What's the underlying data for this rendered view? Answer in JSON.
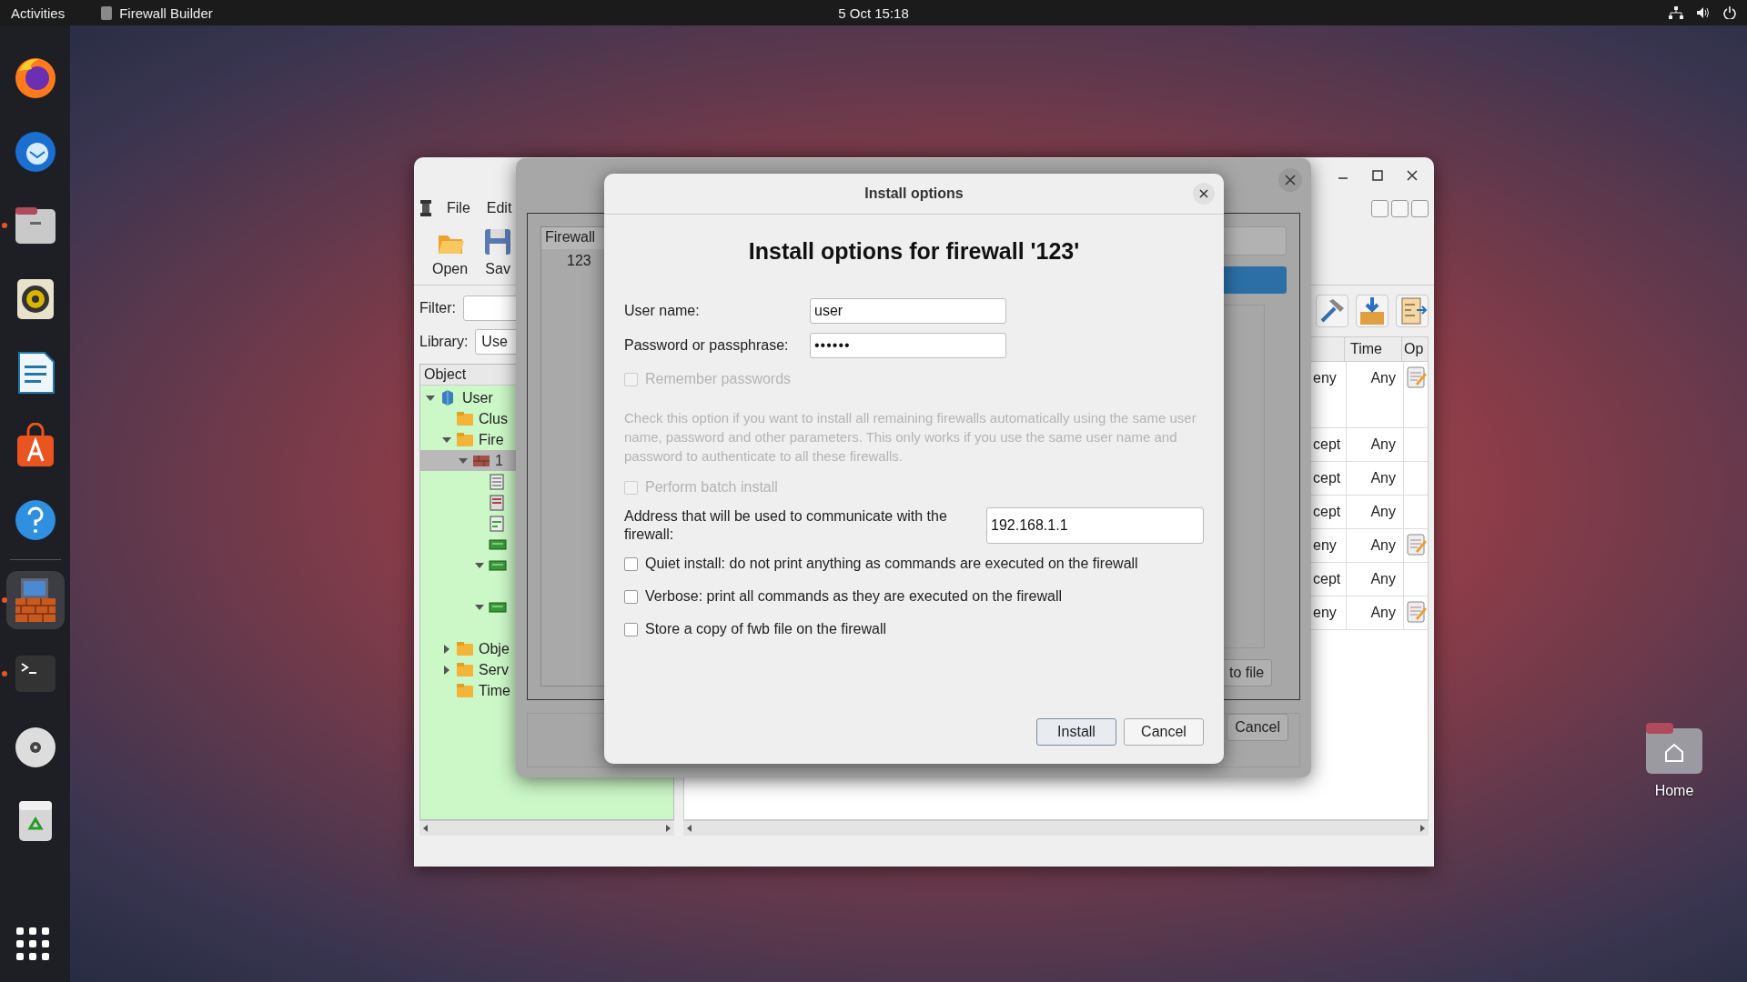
{
  "top_bar": {
    "activities": "Activities",
    "app_name": "Firewall Builder",
    "clock": "5 Oct  15:18"
  },
  "dock": [
    {
      "kind": "firefox",
      "running": false,
      "selected": false
    },
    {
      "kind": "mail",
      "running": false,
      "selected": false
    },
    {
      "kind": "files",
      "running": true,
      "selected": false
    },
    {
      "kind": "speaker",
      "running": false,
      "selected": false
    },
    {
      "kind": "writer",
      "running": false,
      "selected": false
    },
    {
      "kind": "store",
      "running": false,
      "selected": false
    },
    {
      "kind": "help",
      "running": false,
      "selected": false
    },
    {
      "kind": "firewall",
      "running": true,
      "selected": true
    },
    {
      "kind": "terminal",
      "running": true,
      "selected": false
    },
    {
      "kind": "disc",
      "running": false,
      "selected": false
    },
    {
      "kind": "trash",
      "running": false,
      "selected": false
    }
  ],
  "desktop": {
    "home_label": "Home"
  },
  "main_window": {
    "menu": [
      "File",
      "Edit"
    ],
    "toolbar": [
      "Open",
      "Sav"
    ],
    "filter_label": "Filter:",
    "library_label": "Library:",
    "library_value": "Use",
    "tree_header": "Object",
    "tree": [
      {
        "label": "User",
        "kind": "library",
        "expanded": true,
        "selected": false,
        "children": [
          {
            "label": "Clus",
            "kind": "folder",
            "selected": false
          },
          {
            "label": "Fire",
            "kind": "folder",
            "expanded": true,
            "selected": false,
            "children": [
              {
                "label": "1",
                "kind": "firewall",
                "expanded": true,
                "selected": true,
                "children": [
                  {
                    "kind": "policy",
                    "selected": false
                  },
                  {
                    "kind": "nat",
                    "selected": false
                  },
                  {
                    "kind": "routing",
                    "selected": false
                  },
                  {
                    "kind": "interface",
                    "selected": false
                  },
                  {
                    "kind": "interface",
                    "expanded": true,
                    "selected": false
                  },
                  {
                    "kind": "interface",
                    "expanded": true,
                    "selected": false
                  }
                ]
              }
            ]
          },
          {
            "label": "Obje",
            "kind": "folder",
            "expanded": false,
            "selected": false
          },
          {
            "label": "Serv",
            "kind": "folder",
            "expanded": false,
            "selected": false
          },
          {
            "label": "Time",
            "kind": "folder",
            "selected": false
          }
        ]
      }
    ],
    "rules": {
      "columns": [
        "Time",
        "Op"
      ],
      "rows": [
        {
          "column_1": "eny",
          "time": "Any",
          "comment": true,
          "tall": true
        },
        {
          "column_1": "cept",
          "time": "Any",
          "comment": false,
          "tall": false
        },
        {
          "column_1": "cept",
          "time": "Any",
          "comment": false,
          "tall": false
        },
        {
          "column_1": "cept",
          "time": "Any",
          "comment": false,
          "tall": false
        },
        {
          "column_1": "eny",
          "time": "Any",
          "comment": true,
          "tall": false
        },
        {
          "column_1": "cept",
          "time": "Any",
          "comment": false,
          "tall": false
        },
        {
          "column_1": "eny",
          "time": "Any",
          "comment": true,
          "tall": false
        }
      ]
    }
  },
  "wizard": {
    "progress": {
      "level": 1
    },
    "list_header": "Firewall",
    "list_item": "123",
    "save_button": "to file",
    "cancel_button": "Cancel"
  },
  "dialog": {
    "title": "Install options",
    "heading": "Install options for firewall '123'",
    "fields": [
      {
        "label": "User name:",
        "value": "user",
        "kind": "text"
      },
      {
        "label": "Password or passphrase:",
        "value": "••••••",
        "kind": "password"
      }
    ],
    "remember": {
      "label": "Remember passwords",
      "checked": false,
      "disabled": true
    },
    "hint": "Check this option if you want to install all remaining firewalls automatically using the same user name, password and other parameters. This only works if you use the same user name and password to authenticate to all these firewalls.",
    "batch": {
      "label": "Perform batch install",
      "checked": false,
      "disabled": true
    },
    "address": {
      "label": "Address that will be used to communicate with the firewall:",
      "value": "192.168.1.1"
    },
    "options": [
      {
        "label": "Quiet install: do not print anything as commands are executed on the firewall",
        "checked": false,
        "disabled": false
      },
      {
        "label": "Verbose: print all commands as they are executed on the firewall",
        "checked": false,
        "disabled": false
      },
      {
        "label": "Store a copy of fwb file on the firewall",
        "checked": false,
        "disabled": false
      }
    ],
    "buttons": [
      {
        "label": "Install",
        "default": true
      },
      {
        "label": "Cancel",
        "default": false
      }
    ]
  }
}
